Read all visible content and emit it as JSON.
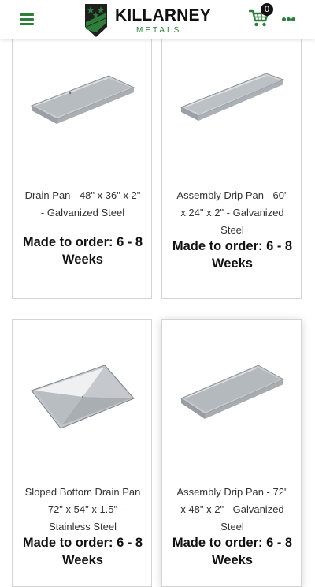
{
  "header": {
    "menu_icon": "hamburger-menu-icon",
    "brand_name": "KILLARNEY",
    "brand_sub": "METALS",
    "cart_icon": "shopping-cart-icon",
    "cart_count": "0",
    "more_icon": "more-dots-icon",
    "accent_color": "#2e7d3a"
  },
  "products": [
    {
      "name": "Drain Pan - 48\" x 36\" x 2\" - Galvanized Steel",
      "availability": "Made to order: 6 - 8 Weeks",
      "image": "galvanized-drain-pan-image"
    },
    {
      "name": "Assembly Drip Pan - 60\" x 24\" x 2\" - Galvanized Steel",
      "availability": "Made to order: 6 - 8 Weeks",
      "image": "galvanized-drip-pan-image"
    },
    {
      "name": "Sloped Bottom Drain Pan - 72\" x 54\" x 1.5\" - Stainless Steel",
      "availability": "Made to order: 6 - 8 Weeks",
      "image": "stainless-sloped-pan-image"
    },
    {
      "name": "Assembly Drip Pan - 72\" x 48\" x 2\" - Galvanized Steel",
      "availability": "Made to order: 6 - 8 Weeks",
      "image": "galvanized-drip-pan-image"
    }
  ]
}
